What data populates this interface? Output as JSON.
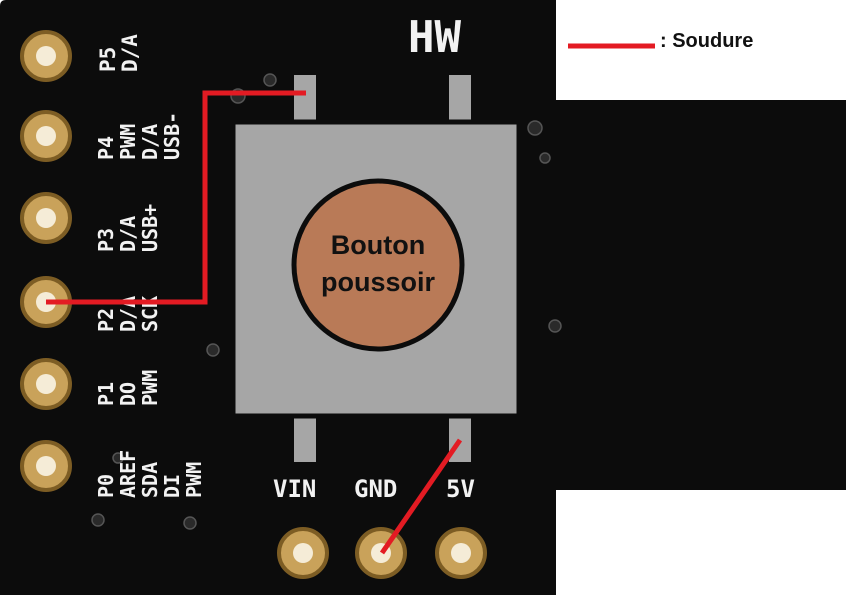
{
  "board": {
    "brand": "HW",
    "pin_labels": [
      [
        "P5",
        "D/A"
      ],
      [
        "P4",
        "PWM",
        "D/A",
        "USB-"
      ],
      [
        "P3",
        "D/A",
        "USB+"
      ],
      [
        "P2",
        "D/A",
        "SCK"
      ],
      [
        "P1",
        "DO",
        "PWM"
      ],
      [
        "P0",
        "AREF",
        "SDA",
        "DI",
        "PWM"
      ]
    ],
    "bottom_pins": [
      "VIN",
      "GND",
      "5V"
    ]
  },
  "button": {
    "line1": "Bouton",
    "line2": "poussoir"
  },
  "legend": {
    "label": ": Soudure",
    "color": "#e31b23"
  },
  "colors": {
    "pcb": "#0c0c0c",
    "button_body": "#a6a6a6",
    "button_cap": "#b97a57",
    "gold": "#caa45a"
  }
}
